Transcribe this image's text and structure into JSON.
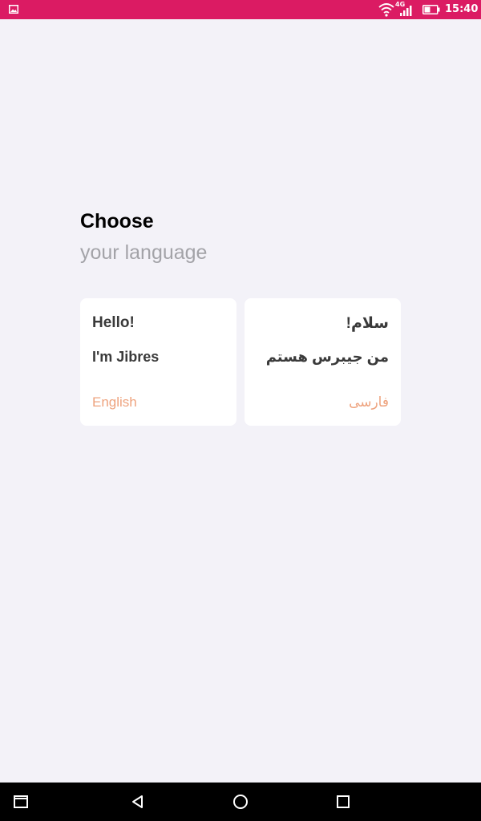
{
  "status_bar": {
    "network_type": "4G",
    "time": "15:40",
    "background_color": "#db1b63"
  },
  "heading": {
    "title": "Choose",
    "subtitle": "your language"
  },
  "languages": [
    {
      "greeting": "Hello!",
      "intro": "I'm Jibres",
      "language_name": "English"
    },
    {
      "greeting": "سلام!",
      "intro": "من جیبرس هستم",
      "language_name": "فارسی"
    }
  ],
  "colors": {
    "background": "#f3f2f8",
    "card": "#ffffff",
    "accent": "#eea37e",
    "subtitle": "#a3a3a8"
  },
  "icons": {
    "status_left": "image-icon",
    "wifi": "wifi-icon",
    "signal": "signal-icon",
    "battery": "battery-icon",
    "nav_back": "back-triangle-icon",
    "nav_home": "home-circle-icon",
    "nav_recents": "recents-square-icon"
  }
}
